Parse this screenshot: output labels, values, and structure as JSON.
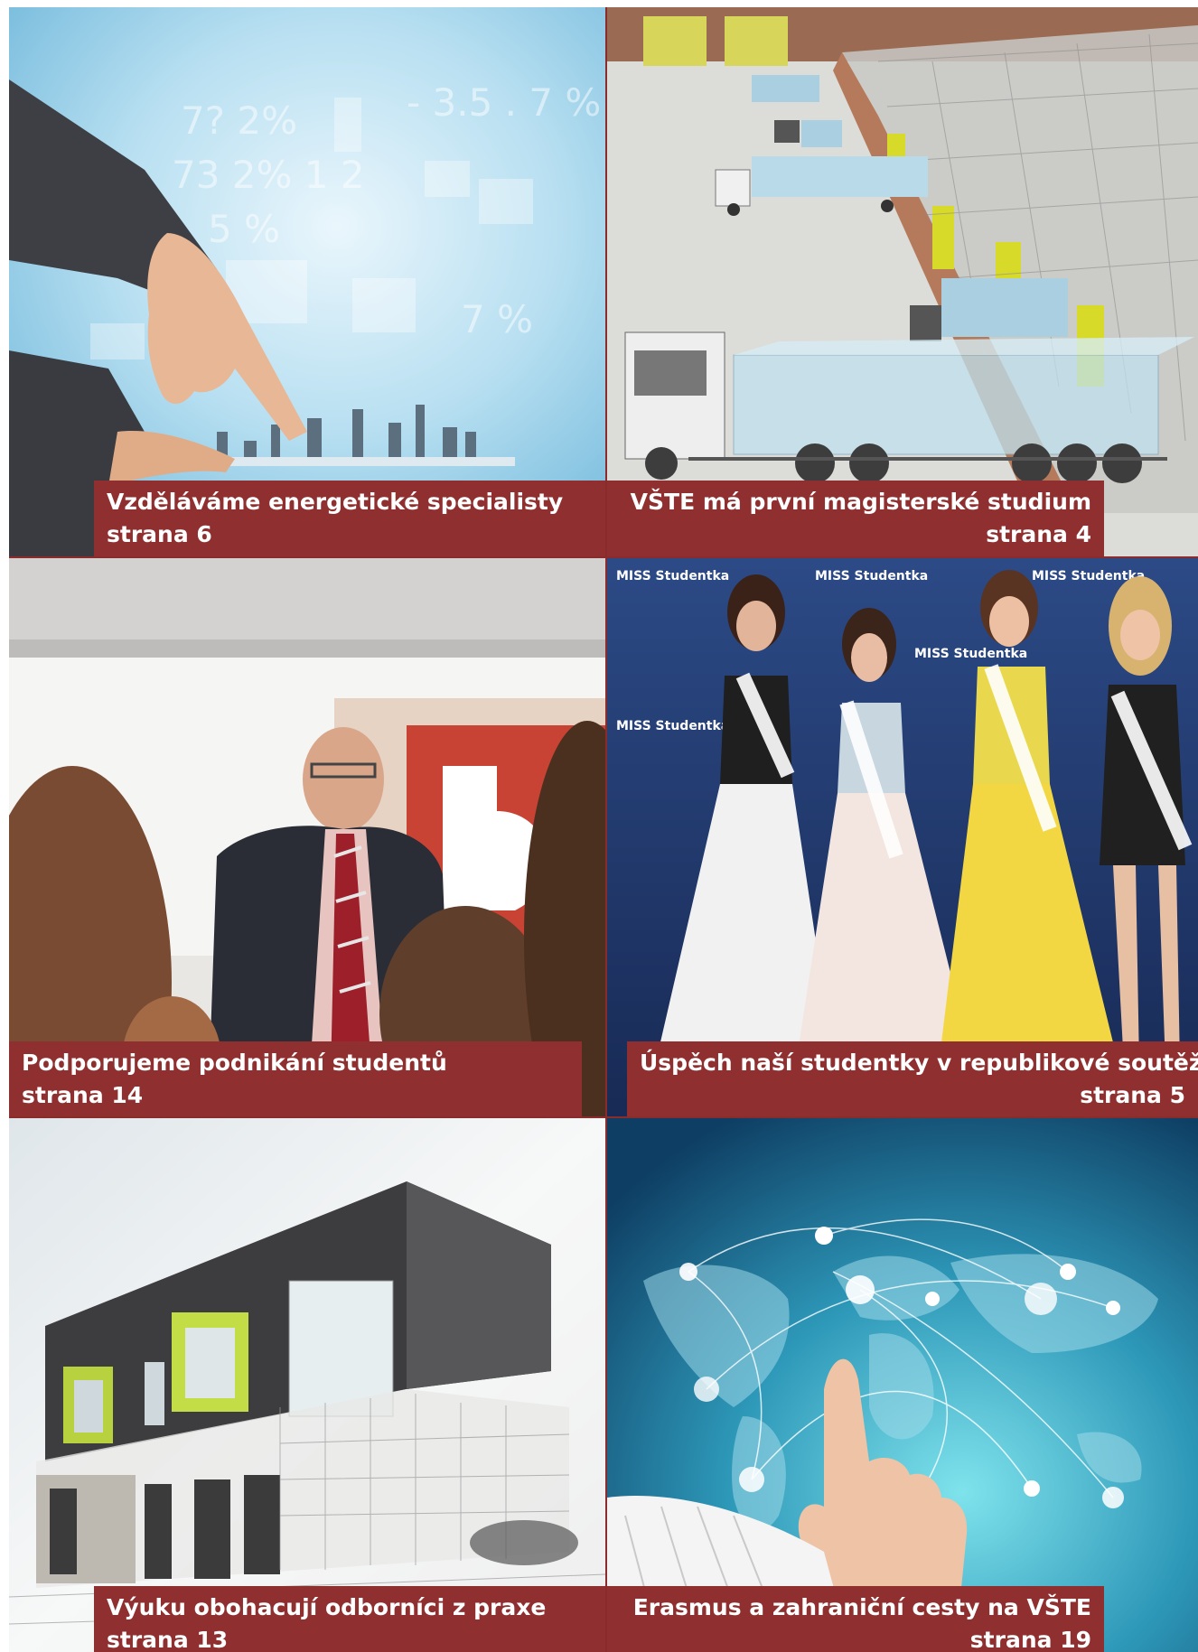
{
  "articles": [
    {
      "title": "Vzděláváme energetické specialisty",
      "page": "strana 6"
    },
    {
      "title": "VŠTE má první magisterské studium",
      "page": "strana 4"
    },
    {
      "title": "Podporujeme podnikání studentů",
      "page": "strana 14"
    },
    {
      "title": "Úspěch naší studentky v republikové soutěži",
      "page": "strana 5"
    },
    {
      "title": "Výuku obohacují odborníci z praxe",
      "page": "strana 13"
    },
    {
      "title": "Erasmus a zahraniční cesty na VŠTE",
      "page": "strana  19"
    }
  ],
  "photo_texts": {
    "sash_label": "MISS Studentka"
  },
  "colors": {
    "caption_bg": "#8f2f2f",
    "frame": "#8b2c2c"
  }
}
